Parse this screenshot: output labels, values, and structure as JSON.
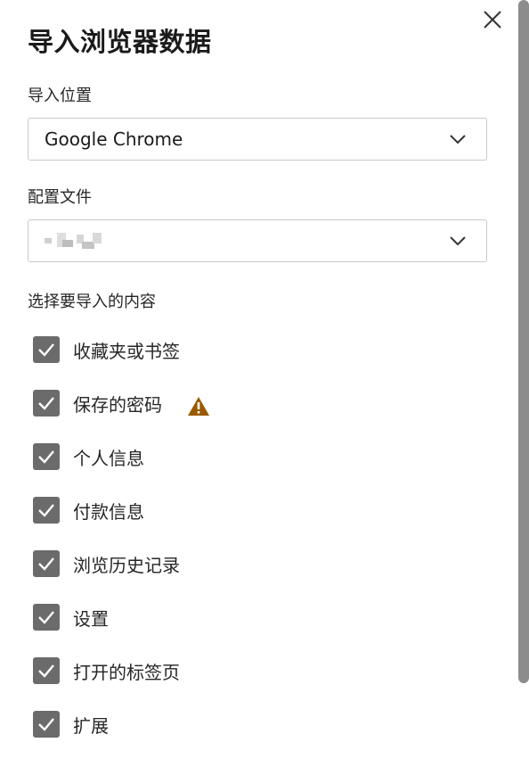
{
  "dialog": {
    "title": "导入浏览器数据"
  },
  "import_from": {
    "label": "导入位置",
    "selected": "Google Chrome"
  },
  "profile": {
    "label": "配置文件",
    "selected_note": "blurred"
  },
  "choose": {
    "label": "选择要导入的内容",
    "items": [
      {
        "label": "收藏夹或书签",
        "checked": true
      },
      {
        "label": "保存的密码",
        "checked": true,
        "warning": true
      },
      {
        "label": "个人信息",
        "checked": true
      },
      {
        "label": "付款信息",
        "checked": true
      },
      {
        "label": "浏览历史记录",
        "checked": true
      },
      {
        "label": "设置",
        "checked": true
      },
      {
        "label": "打开的标签页",
        "checked": true
      },
      {
        "label": "扩展",
        "checked": true
      }
    ]
  },
  "colors": {
    "checkbox": "#6b6b6b",
    "warning": "#9a5a00",
    "scrollbar": "#8c8c8c"
  }
}
